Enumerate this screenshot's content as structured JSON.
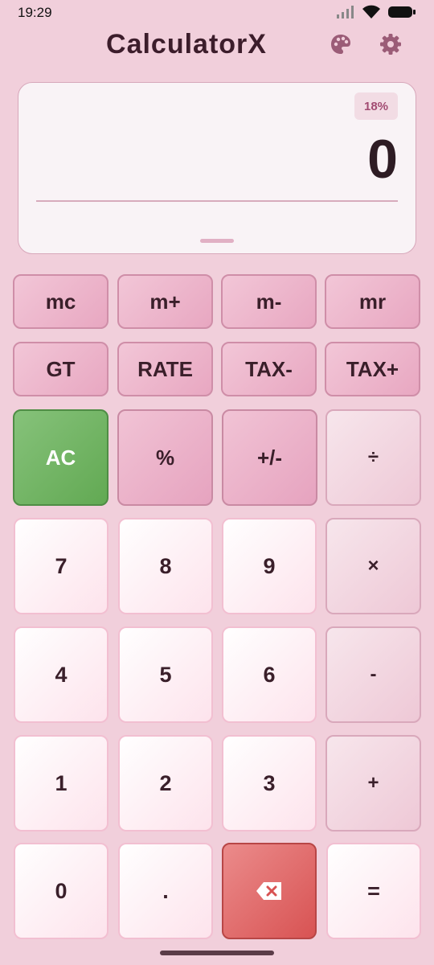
{
  "status": {
    "time": "19:29"
  },
  "app": {
    "title": "CalculatorX"
  },
  "display": {
    "tax_rate": "18%",
    "value": "0"
  },
  "keys": {
    "memory": [
      "mc",
      "m+",
      "m-",
      "mr"
    ],
    "tax": [
      "GT",
      "RATE",
      "TAX-",
      "TAX+"
    ],
    "functions": [
      "AC",
      "%",
      "+/-",
      "÷"
    ],
    "row7": [
      "7",
      "8",
      "9",
      "×"
    ],
    "row4": [
      "4",
      "5",
      "6",
      "-"
    ],
    "row1": [
      "1",
      "2",
      "3",
      "+"
    ],
    "row0": [
      "0",
      ".",
      "="
    ]
  },
  "colors": {
    "background": "#f1cfdb",
    "ac_key": "#6fb262",
    "backspace_key": "#e06b6b",
    "accent": "#a24b72"
  }
}
